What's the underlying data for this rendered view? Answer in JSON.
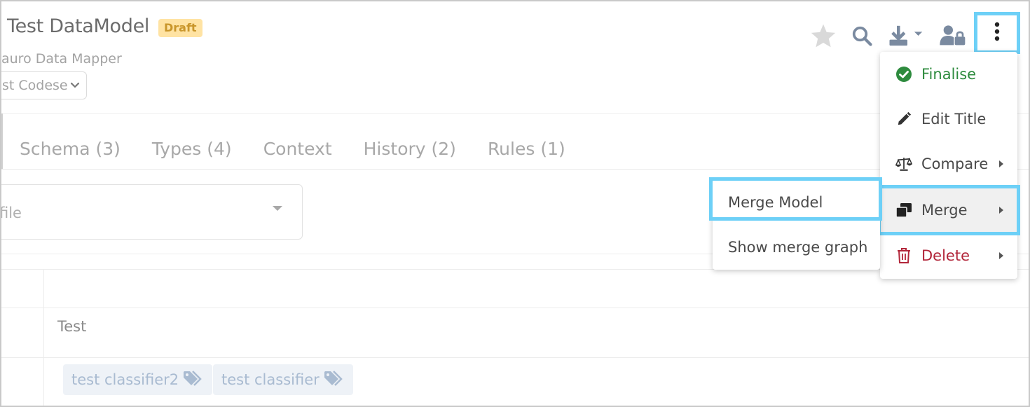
{
  "header": {
    "title": "Test DataModel",
    "status_badge": "Draft",
    "subtitle": "auro Data Mapper",
    "version_select_value": "st Codese"
  },
  "toolbar": {
    "icons": [
      "star-icon",
      "search-icon",
      "download-icon",
      "user-lock-icon",
      "more-vertical-icon"
    ]
  },
  "tabs": [
    {
      "label": "Schema (3)"
    },
    {
      "label": "Types (4)"
    },
    {
      "label": "Context"
    },
    {
      "label": "History (2)"
    },
    {
      "label": "Rules (1)"
    }
  ],
  "profile": {
    "placeholder": "file"
  },
  "content": {
    "row_text": "Test",
    "tags": [
      "test classifier2",
      "test classifier"
    ]
  },
  "menu": {
    "items": [
      {
        "label": "Finalise",
        "icon": "check-circle-icon",
        "color": "#2e8b3e"
      },
      {
        "label": "Edit Title",
        "icon": "pencil-icon",
        "color": "#4a4a4a"
      },
      {
        "label": "Compare",
        "icon": "balance-scale-icon",
        "color": "#4a4a4a"
      },
      {
        "label": "Merge",
        "icon": "merge-copy-icon",
        "color": "#4a4a4a"
      },
      {
        "label": "Delete",
        "icon": "trash-icon",
        "color": "#b2263a"
      }
    ],
    "submenu": [
      {
        "label": "Merge Model"
      },
      {
        "label": "Show merge graph"
      }
    ]
  },
  "colors": {
    "highlight": "#6dd0f7",
    "badge_bg": "#ffe3a3",
    "badge_text": "#c9962b",
    "success": "#2e8b3e",
    "danger": "#b2263a",
    "tag_bg": "#eef2f7",
    "tag_text": "#a9bbd1"
  }
}
